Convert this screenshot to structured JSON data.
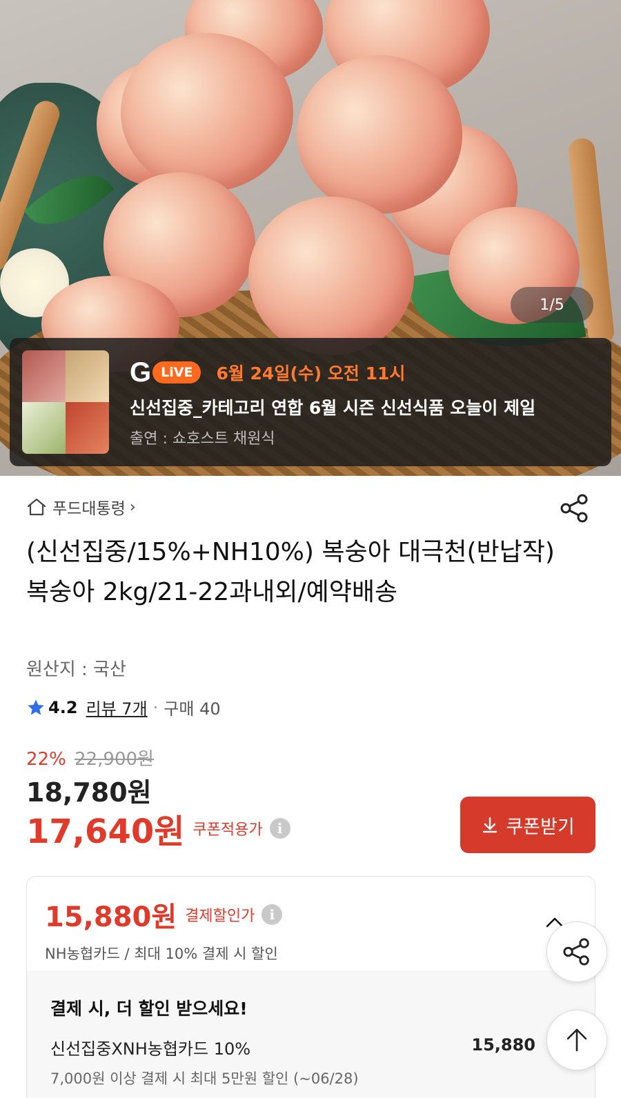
{
  "hero": {
    "page_counter": "1/5"
  },
  "live_banner": {
    "logo_g": "G",
    "logo_live": "LiVE",
    "date": "6월 24일(수) 오전 11시",
    "title": "신선집중_카테고리 연합 6월 시즌 신선식품 오늘이 제일",
    "host": "출연 : 쇼호스트 채원식"
  },
  "breadcrumb": {
    "label": "푸드대통령",
    "chevron": "›"
  },
  "product": {
    "title": "(신선집중/15%+NH10%) 복숭아 대극천(반납작) 복숭아 2kg/21-22과내외/예약배송",
    "origin": "원산지 : 국산",
    "rating": "4.2",
    "reviews": "리뷰 7개",
    "purchase": "구매 40"
  },
  "pricing": {
    "discount_pct": "22%",
    "original_price": "22,900원",
    "sale_price": "18,780원",
    "coupon_price": "17,640원",
    "coupon_label": "쿠폰적용가",
    "coupon_button": "쿠폰받기"
  },
  "payment_card": {
    "price": "15,880원",
    "price_label": "결제할인가",
    "subtitle": "NH농협카드 / 최대 10% 결제 시 할인",
    "heading": "결제 시, 더 할인 받으세요!",
    "offer_name": "신선집중XNH농협카드 10%",
    "offer_value": "15,880",
    "offer_desc": "7,000원 이상 결제 시 최대 5만원 할인 (~06/28)"
  },
  "colors": {
    "accent_red": "#d63a2b",
    "live_orange": "#ff6a1e",
    "star_blue": "#2f6ee8"
  },
  "icons": {
    "home": "home-icon",
    "share": "share-icon",
    "star": "star-icon",
    "download": "download-icon",
    "info": "info-icon",
    "arrow_up": "arrow-up-icon"
  }
}
